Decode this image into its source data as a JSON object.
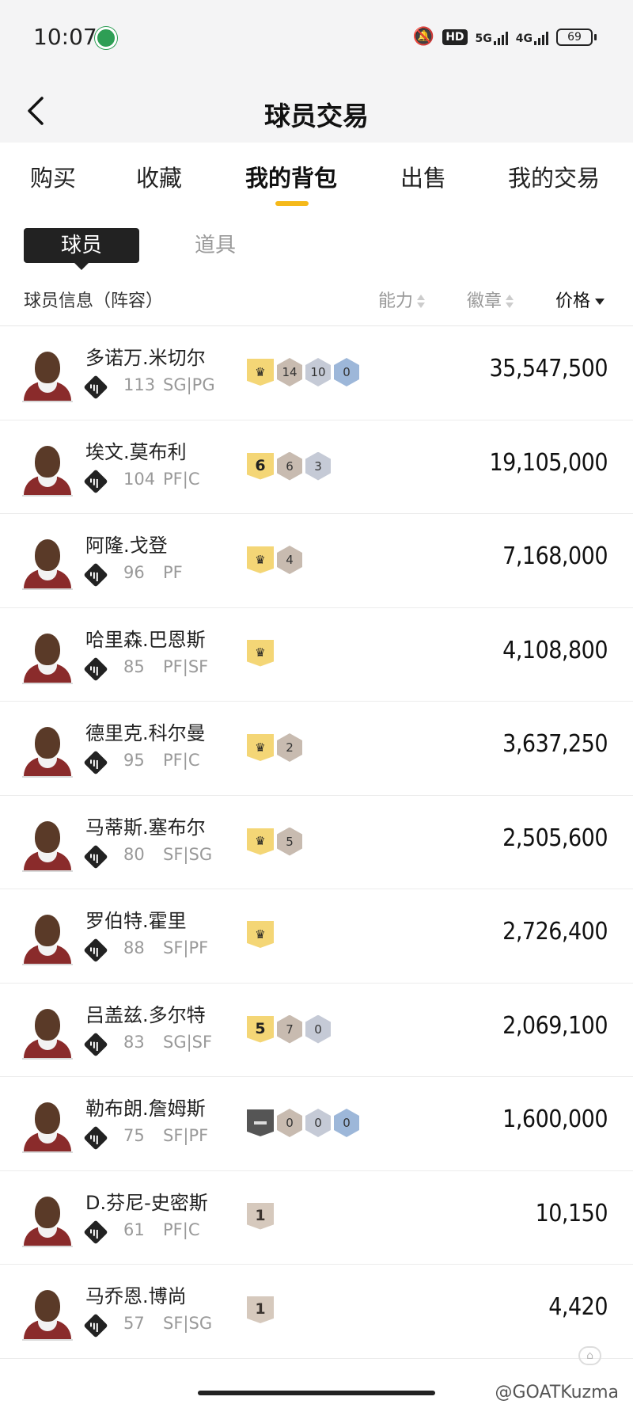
{
  "status_bar": {
    "time": "10:07",
    "hd": "HD",
    "net1": "5G",
    "net2": "4G",
    "battery": "69"
  },
  "header": {
    "title": "球员交易",
    "back_icon": "chevron-left-icon"
  },
  "tabs": [
    "购买",
    "收藏",
    "我的背包",
    "出售",
    "我的交易"
  ],
  "active_tab": "我的背包",
  "segments": {
    "players": "球员",
    "items": "道具"
  },
  "columns": {
    "info": "球员信息（阵容）",
    "ability": "能力",
    "badge": "徽章",
    "price": "价格"
  },
  "players": [
    {
      "name": "多诺万.米切尔",
      "ovr": "113",
      "pos": "SG|PG",
      "price": "35,547,500",
      "badges": [
        {
          "type": "crown",
          "label": ""
        },
        {
          "type": "bronze",
          "label": "14"
        },
        {
          "type": "silver",
          "label": "10"
        },
        {
          "type": "blue",
          "label": "0"
        }
      ]
    },
    {
      "name": "埃文.莫布利",
      "ovr": "104",
      "pos": "PF|C",
      "price": "19,105,000",
      "badges": [
        {
          "type": "gold",
          "label": "6"
        },
        {
          "type": "bronze",
          "label": "6"
        },
        {
          "type": "silver",
          "label": "3"
        }
      ]
    },
    {
      "name": "阿隆.戈登",
      "ovr": "96",
      "pos": "PF",
      "price": "7,168,000",
      "badges": [
        {
          "type": "crown",
          "label": ""
        },
        {
          "type": "bronze",
          "label": "4"
        }
      ]
    },
    {
      "name": "哈里森.巴恩斯",
      "ovr": "85",
      "pos": "PF|SF",
      "price": "4,108,800",
      "badges": [
        {
          "type": "crown",
          "label": ""
        }
      ]
    },
    {
      "name": "德里克.科尔曼",
      "ovr": "95",
      "pos": "PF|C",
      "price": "3,637,250",
      "badges": [
        {
          "type": "crown",
          "label": ""
        },
        {
          "type": "bronze",
          "label": "2"
        }
      ]
    },
    {
      "name": "马蒂斯.塞布尔",
      "ovr": "80",
      "pos": "SF|SG",
      "price": "2,505,600",
      "badges": [
        {
          "type": "crown",
          "label": ""
        },
        {
          "type": "bronze",
          "label": "5"
        }
      ]
    },
    {
      "name": "罗伯特.霍里",
      "ovr": "88",
      "pos": "SF|PF",
      "price": "2,726,400",
      "badges": [
        {
          "type": "crown",
          "label": ""
        }
      ]
    },
    {
      "name": "吕盖兹.多尔特",
      "ovr": "83",
      "pos": "SG|SF",
      "price": "2,069,100",
      "badges": [
        {
          "type": "gold",
          "label": "5"
        },
        {
          "type": "bronze",
          "label": "7"
        },
        {
          "type": "silver",
          "label": "0"
        }
      ]
    },
    {
      "name": "勒布朗.詹姆斯",
      "ovr": "75",
      "pos": "SF|PF",
      "price": "1,600,000",
      "badges": [
        {
          "type": "dark",
          "label": ""
        },
        {
          "type": "bronze",
          "label": "0"
        },
        {
          "type": "silver",
          "label": "0"
        },
        {
          "type": "blue",
          "label": "0"
        }
      ]
    },
    {
      "name": "D.芬尼-史密斯",
      "ovr": "61",
      "pos": "PF|C",
      "price": "10,150",
      "badges": [
        {
          "type": "num-bronze",
          "label": "1"
        }
      ]
    },
    {
      "name": "马乔恩.博尚",
      "ovr": "57",
      "pos": "SF|SG",
      "price": "4,420",
      "badges": [
        {
          "type": "num-bronze",
          "label": "1"
        }
      ]
    }
  ],
  "watermark": "@GOATKuzma",
  "accent_color": "#f5b91a"
}
